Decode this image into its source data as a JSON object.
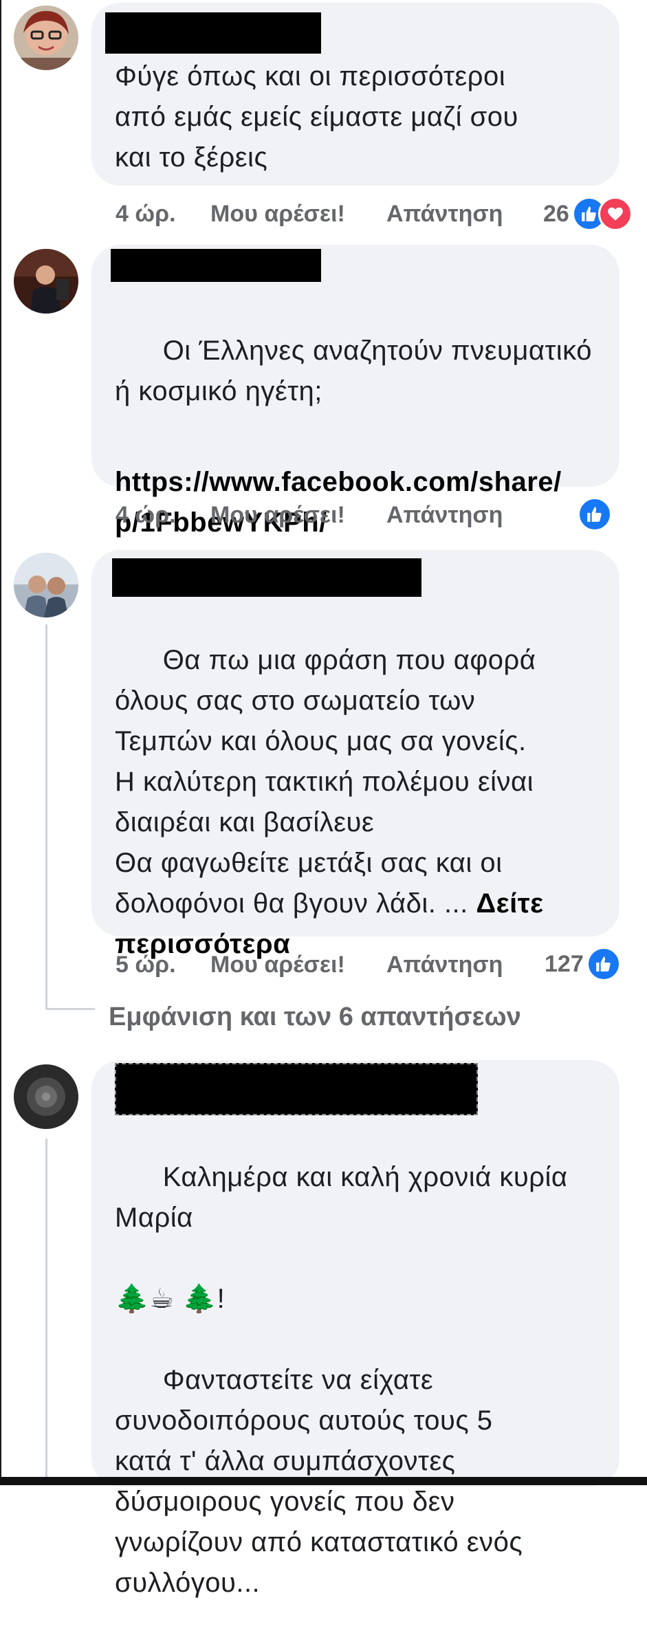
{
  "comments": [
    {
      "text": "Φύγε όπως και οι περισσότεροι\nαπό εμάς εμείς είμαστε μαζί σου\nκαι το ξέρεις",
      "time": "4 ώρ.",
      "like_label": "Μου αρέσει!",
      "reply_label": "Απάντηση",
      "reaction_count": "26"
    },
    {
      "text": "Οι Έλληνες αναζητούν πνευματικό\nή κοσμικό ηγέτη;",
      "link": "https://www.facebook.com/share/\np/1FbbewYKPh/",
      "time": "4 ώρ.",
      "like_label": "Μου αρέσει!",
      "reply_label": "Απάντηση",
      "reaction_count": ""
    },
    {
      "text": "Θα πω μια φράση που αφορά\nόλους σας στο σωματείο των\nΤεμπών και όλους μας σα γονείς.\nΗ καλύτερη τακτική πολέμου είναι\nδιαιρέαι και βασίλευε\nΘα φαγωθείτε μετάξι σας και οι\nδολοφόνοι θα βγουν λάδι. ... ",
      "see_more": "Δείτε\nπερισσότερα",
      "time": "5 ώρ.",
      "like_label": "Μου αρέσει!",
      "reply_label": "Απάντηση",
      "reaction_count": "127",
      "view_replies": "Εμφάνιση και των 6 απαντήσεων"
    },
    {
      "text_line1": "Καλημέρα και καλή χρονιά κυρία\nΜαρία",
      "emoji_line": "🌲☕ 🌲!",
      "text_line2": "Φανταστείτε να είχατε\nσυνοδοιπόρους αυτούς τους 5\nκατά τ' άλλα συμπάσχοντες\nδύσμοιρους γονείς που δεν\nγνωρίζουν από καταστατικό ενός\nσυλλόγου..."
    }
  ],
  "colors": {
    "bubble": "#f0f2f5",
    "like_blue": "#1877f2",
    "love_red": "#f33e58",
    "meta_gray": "#65676b"
  }
}
